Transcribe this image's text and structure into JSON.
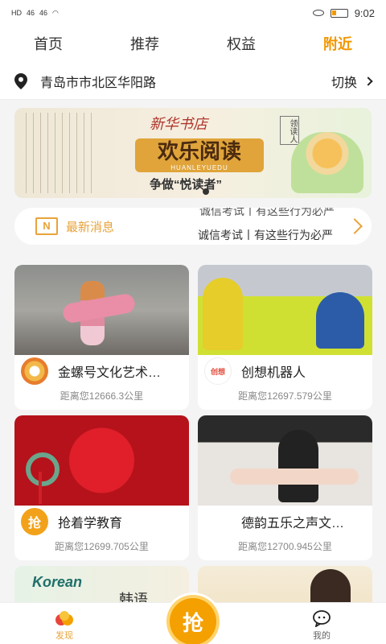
{
  "status": {
    "time": "9:02",
    "signal1": "46",
    "signal2": "46",
    "hd1": "HD",
    "hd2": "HD"
  },
  "nav": {
    "tabs": [
      "首页",
      "推荐",
      "权益",
      "附近"
    ],
    "active": 3
  },
  "location": {
    "address": "青岛市市北区华阳路",
    "switch_label": "切换"
  },
  "banner": {
    "store": "新华书店",
    "title": "欢乐阅读",
    "pinyin": "HUANLEYUEDU",
    "subtitle": "争做“悦读者”",
    "badge": "领读人"
  },
  "news": {
    "icon_text": "N",
    "label": "最新消息",
    "line1": "诚信考试丨有这些行为必严",
    "line2": "诚信考试丨有这些行为必严"
  },
  "cards": [
    {
      "name": "金螺号文化艺术…",
      "distance": "距离您12666.3公里",
      "avatar_color": "#f2b94a"
    },
    {
      "name": "创想机器人",
      "distance": "距离您12697.579公里",
      "avatar_color": "#ffffff"
    },
    {
      "name": "抢着学教育",
      "distance": "距离您12699.705公里",
      "avatar_color": "#f2a21a",
      "avatar_text": "抢"
    },
    {
      "name": "德韵五乐之声文…",
      "distance": "距离您12700.945公里",
      "avatar_color": "#ffffff"
    }
  ],
  "partial_cards": {
    "korean": "Korean",
    "hanyu": "韩语"
  },
  "tabbar": {
    "discover": "发现",
    "center": "抢",
    "mine": "我的"
  }
}
